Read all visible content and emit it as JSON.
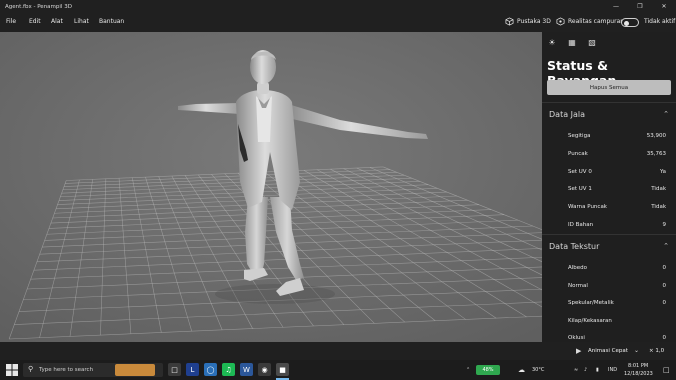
{
  "window": {
    "title": "Agent.fbx - Penampil 3D"
  },
  "menu": [
    "File",
    "Edit",
    "Alat",
    "Lihat",
    "Bantuan"
  ],
  "toolbar": {
    "library_label": "Pustaka 3D",
    "mixed_reality_label": "Realitas campuran",
    "toggle_state_label": "Tidak aktif"
  },
  "panel": {
    "title": "Status & Bayangan",
    "clear_button": "Hapus Semua",
    "mesh_section": {
      "title": "Data Jala",
      "rows": [
        {
          "label": "Segitiga",
          "value": "53,900"
        },
        {
          "label": "Puncak",
          "value": "35,763"
        },
        {
          "label": "Set UV 0",
          "value": "Ya"
        },
        {
          "label": "Set UV 1",
          "value": "Tidak"
        },
        {
          "label": "Warna Puncak",
          "value": "Tidak"
        },
        {
          "label": "ID Bahan",
          "value": "9"
        }
      ]
    },
    "texture_section": {
      "title": "Data Tekstur",
      "rows": [
        {
          "label": "Albedo",
          "value": "0"
        },
        {
          "label": "Normal",
          "value": "0"
        },
        {
          "label": "Spekular/Metalik",
          "value": "0"
        },
        {
          "label": "Kilap/Kekasaran",
          "value": ""
        },
        {
          "label": "Oklusi",
          "value": "0"
        }
      ]
    }
  },
  "statusbar": {
    "animation_label": "Animasi Cepat",
    "speed_label": "× 1,0"
  },
  "taskbar": {
    "search_placeholder": "Type here to search",
    "battery": "48%",
    "weather": "30°C",
    "language": "IND",
    "time": "8:01 PM",
    "date": "12/18/2023"
  },
  "colors": {
    "viewport_bg": "#6a6a6a",
    "panel_bg": "#1f1f1f",
    "button_bg": "#bdbdbd",
    "battery_green": "#2fa84f"
  }
}
